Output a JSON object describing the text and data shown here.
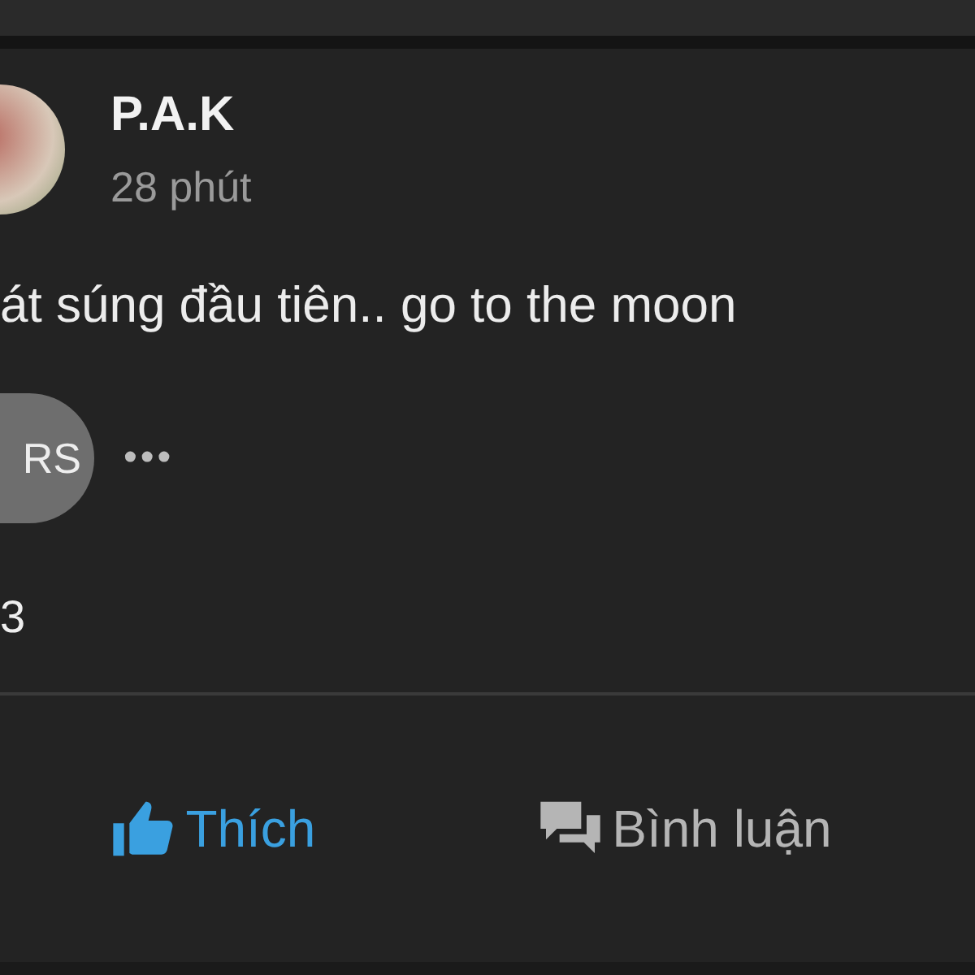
{
  "post": {
    "author": "P.A.K",
    "time": "28 phút",
    "text": "át súng đầu tiên.. go to the moon",
    "tag": "RS",
    "more": "•••",
    "count": "3"
  },
  "actions": [
    {
      "kind": "like",
      "label": "Thích",
      "selected": true
    },
    {
      "kind": "comment",
      "label": "Bình luận",
      "selected": false
    }
  ]
}
